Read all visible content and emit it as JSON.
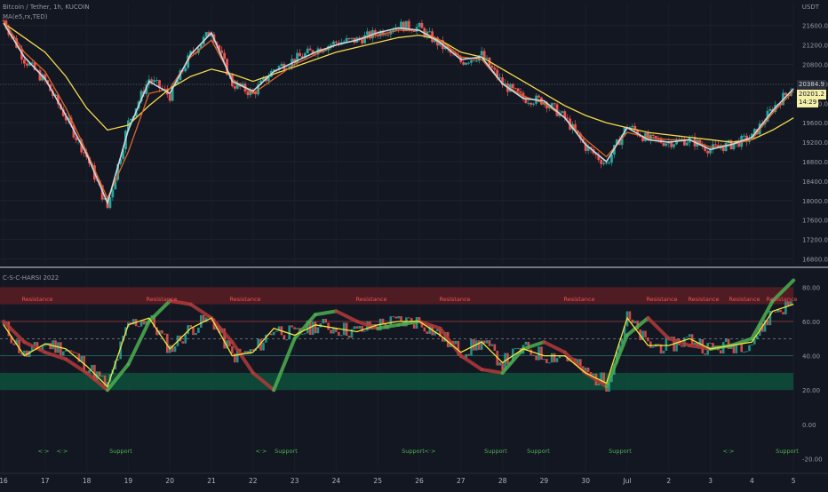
{
  "header": {
    "symbol": "Bitcoin / Tether, 1h, KUCOIN",
    "study": "MA(e5,rx,TED)"
  },
  "indicator": {
    "title": "C-S-C-HARSI 2022"
  },
  "colors": {
    "background": "#131722",
    "up": "#26a69a",
    "down": "#ef5350",
    "ma_yellow": "#f5d94e",
    "ma_orange": "#e0642a",
    "ma_white": "#c8d8e0",
    "rsi_line": "#f5e63c",
    "resistance_band": "#5a1d24",
    "support_band": "#0e4d3a",
    "support_text": "#4caf50",
    "resistance_text": "#ef5350"
  },
  "price_pane": {
    "currency": "USDT",
    "ticks": [
      "21600.0",
      "21200.0",
      "20800.0",
      "20400.0",
      "20000.0",
      "19600.0",
      "19200.0",
      "18800.0",
      "18400.0",
      "18000.0",
      "17600.0",
      "17200.0",
      "16800.0"
    ],
    "tick_values": [
      21600,
      21200,
      20800,
      20400,
      20000,
      19600,
      19200,
      18800,
      18400,
      18000,
      17600,
      17200,
      16800
    ],
    "last_price_label": "20384.9",
    "current_price_label": "20201.2",
    "countdown_label": "14:29",
    "ylim": [
      16700,
      22050
    ]
  },
  "rsi_pane": {
    "ticks": [
      "80.00",
      "60.00",
      "40.00",
      "20.00",
      "0.00",
      "-20.00"
    ],
    "tick_values": [
      80,
      60,
      40,
      20,
      0,
      -20
    ],
    "ylim": [
      -27,
      90
    ],
    "resistance_band": [
      70,
      80
    ],
    "support_band": [
      20,
      30
    ],
    "levels": [
      40,
      50,
      60
    ],
    "resistance_labels": [
      "Resistance",
      "Resistance",
      "Resistance",
      "Resistance",
      "Resistance",
      "Resistance",
      "Resistance",
      "Resistance",
      "Resistance",
      "Resistance"
    ],
    "support_labels": [
      "<·>",
      "<·>",
      "Support",
      "<·>",
      "Support",
      "Support",
      "<·>",
      "Support",
      "Support",
      "Support",
      "<·>",
      "Support"
    ]
  },
  "x_axis": {
    "labels": [
      "16",
      "17",
      "18",
      "19",
      "20",
      "21",
      "22",
      "23",
      "24",
      "25",
      "26",
      "27",
      "28",
      "29",
      "30",
      "Jul",
      "2",
      "3",
      "4",
      "5"
    ]
  },
  "chart_data": [
    {
      "type": "candlestick",
      "title": "Bitcoin / Tether, 1h, KUCOIN",
      "ylabel": "USDT",
      "ylim": [
        16700,
        22050
      ],
      "x": [
        "16",
        "16.5",
        "17",
        "17.5",
        "18",
        "18.5",
        "19",
        "19.5",
        "20",
        "20.5",
        "21",
        "21.5",
        "22",
        "22.5",
        "23",
        "23.5",
        "24",
        "24.5",
        "25",
        "25.5",
        "26",
        "26.5",
        "27",
        "27.5",
        "28",
        "28.5",
        "29",
        "29.5",
        "30",
        "30.5",
        "Jul",
        "1.5",
        "2",
        "2.5",
        "3",
        "3.5",
        "4",
        "4.5",
        "5"
      ],
      "close": [
        21700,
        20900,
        20450,
        19700,
        18900,
        17850,
        19600,
        20500,
        20150,
        21000,
        21500,
        20400,
        20200,
        20700,
        20900,
        21100,
        21250,
        21300,
        21450,
        21600,
        21550,
        21200,
        20850,
        21000,
        20400,
        20100,
        20050,
        19700,
        19100,
        18750,
        19550,
        19250,
        19200,
        19250,
        19050,
        19150,
        19300,
        19900,
        20350
      ],
      "series": [
        {
          "name": "",
          "color": "yellow",
          "values": [
            21650,
            21350,
            21050,
            20550,
            19900,
            19450,
            19550,
            19950,
            20300,
            20550,
            20700,
            20600,
            20450,
            20600,
            20750,
            20900,
            21050,
            21150,
            21250,
            21350,
            21400,
            21300,
            21050,
            20950,
            20700,
            20450,
            20200,
            19950,
            19750,
            19600,
            19500,
            19400,
            19350,
            19300,
            19250,
            19200,
            19250,
            19450,
            19700
          ]
        },
        {
          "name": "",
          "color": "orange",
          "values": [
            21700,
            21050,
            20650,
            19900,
            19000,
            18050,
            19000,
            20200,
            20300,
            20950,
            21300,
            20500,
            20200,
            20500,
            20800,
            21000,
            21200,
            21300,
            21400,
            21500,
            21500,
            21300,
            20950,
            20900,
            20400,
            20150,
            20000,
            19700,
            19250,
            18900,
            19400,
            19300,
            19250,
            19250,
            19100,
            19150,
            19250,
            19800,
            20250
          ]
        },
        {
          "name": "",
          "color": "white",
          "values": [
            21650,
            20950,
            20500,
            19750,
            18950,
            17950,
            19450,
            20450,
            20200,
            21000,
            21450,
            20450,
            20250,
            20650,
            20850,
            21050,
            21200,
            21300,
            21450,
            21550,
            21500,
            21250,
            20900,
            20950,
            20400,
            20100,
            20050,
            19700,
            19150,
            18800,
            19500,
            19250,
            19200,
            19250,
            19050,
            19150,
            19300,
            19850,
            20300
          ]
        }
      ]
    },
    {
      "type": "line",
      "title": "C-S-C-HARSI 2022",
      "ylim": [
        -27,
        90
      ],
      "x": [
        "16",
        "16.5",
        "17",
        "17.5",
        "18",
        "18.5",
        "19",
        "19.5",
        "20",
        "20.5",
        "21",
        "21.5",
        "22",
        "22.5",
        "23",
        "23.5",
        "24",
        "24.5",
        "25",
        "25.5",
        "26",
        "26.5",
        "27",
        "27.5",
        "28",
        "28.5",
        "29",
        "29.5",
        "30",
        "30.5",
        "Jul",
        "1.5",
        "2",
        "2.5",
        "3",
        "3.5",
        "4",
        "4.5",
        "5"
      ],
      "series": [
        {
          "name": "",
          "color": "yellow",
          "values": [
            58,
            40,
            47,
            44,
            34,
            22,
            58,
            62,
            44,
            56,
            62,
            40,
            42,
            56,
            52,
            58,
            56,
            54,
            58,
            60,
            60,
            52,
            42,
            48,
            36,
            44,
            40,
            40,
            30,
            24,
            62,
            46,
            46,
            50,
            44,
            46,
            48,
            66,
            70
          ]
        },
        {
          "name": "",
          "color": "trend",
          "values": [
            60,
            48,
            42,
            38,
            30,
            20,
            35,
            60,
            72,
            70,
            62,
            48,
            30,
            20,
            50,
            64,
            66,
            60,
            56,
            58,
            60,
            56,
            40,
            32,
            30,
            44,
            48,
            42,
            30,
            22,
            52,
            62,
            50,
            46,
            44,
            46,
            50,
            72,
            84
          ]
        }
      ]
    }
  ]
}
